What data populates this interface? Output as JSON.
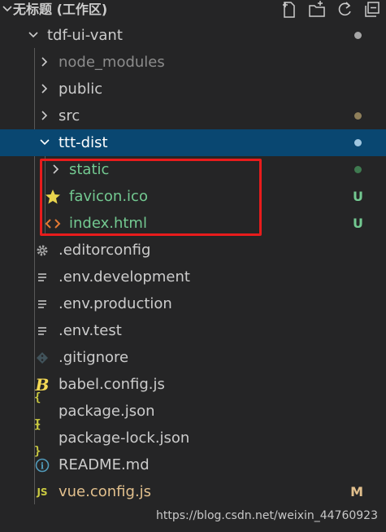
{
  "header": {
    "title": "无标题 (工作区)",
    "actions": [
      "new-file-icon",
      "new-folder-icon",
      "refresh-icon",
      "collapse-all-icon"
    ]
  },
  "tree": {
    "root": "tdf-ui-vant",
    "node_modules": "node_modules",
    "public": "public",
    "src": "src",
    "ttt_dist": "ttt-dist",
    "static": "static",
    "favicon": "favicon.ico",
    "index_html": "index.html",
    "editorconfig": ".editorconfig",
    "env_development": ".env.development",
    "env_production": ".env.production",
    "env_test": ".env.test",
    "gitignore": ".gitignore",
    "babel_config": "babel.config.js",
    "package_json": "package.json",
    "package_lock": "package-lock.json",
    "readme": "README.md",
    "vue_config": "vue.config.js"
  },
  "badges": {
    "favicon": "U",
    "index_html": "U",
    "vue_config": "M"
  },
  "icons": {
    "js_label": "JS",
    "json_label": "{ }",
    "readme_label": "i"
  },
  "colors": {
    "untracked_green": "#73c991",
    "modified_yellow": "#e2c08d",
    "selected_bg": "#094771",
    "red_highlight": "#e81c1c"
  },
  "watermark": "https://blog.csdn.net/weixin_44760923"
}
